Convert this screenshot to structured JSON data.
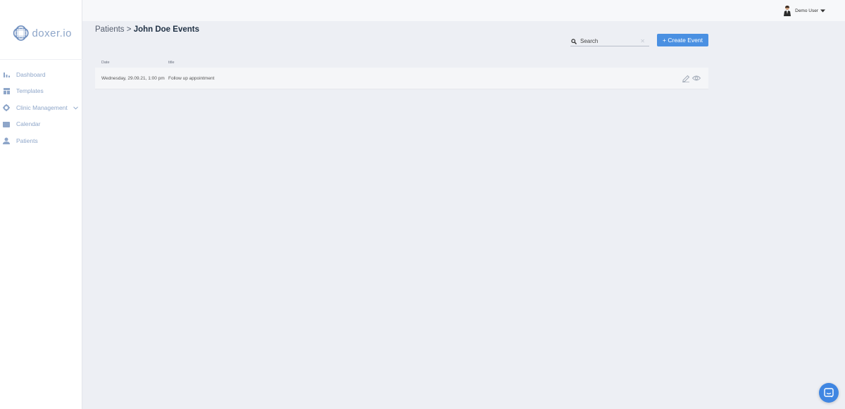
{
  "sidebar": {
    "logo_text": "doxer.io",
    "items": [
      {
        "label": "Dashboard",
        "icon": "bar-chart-icon"
      },
      {
        "label": "Templates",
        "icon": "grid-icon"
      },
      {
        "label": "Clinic Management",
        "icon": "gear-icon"
      },
      {
        "label": "Calendar",
        "icon": "calendar-icon"
      },
      {
        "label": "Patients",
        "icon": "person-icon"
      }
    ]
  },
  "header": {
    "user_name": "Demo User"
  },
  "breadcrumb": {
    "parent": "Patients",
    "separator": ">",
    "current": "John Doe Events"
  },
  "search": {
    "placeholder": "Search",
    "clear_glyph": "✕"
  },
  "toolbar": {
    "create_label": "+ Create Event"
  },
  "table": {
    "columns": [
      "Date",
      "title"
    ],
    "rows": [
      {
        "date": "Wednesday, 29.09.21, 1:00 pm",
        "title": "Follow up appointment"
      }
    ]
  },
  "colors": {
    "accent": "#4a90e2",
    "sidebar_text": "#8ea6c9",
    "background": "#edeff4"
  }
}
